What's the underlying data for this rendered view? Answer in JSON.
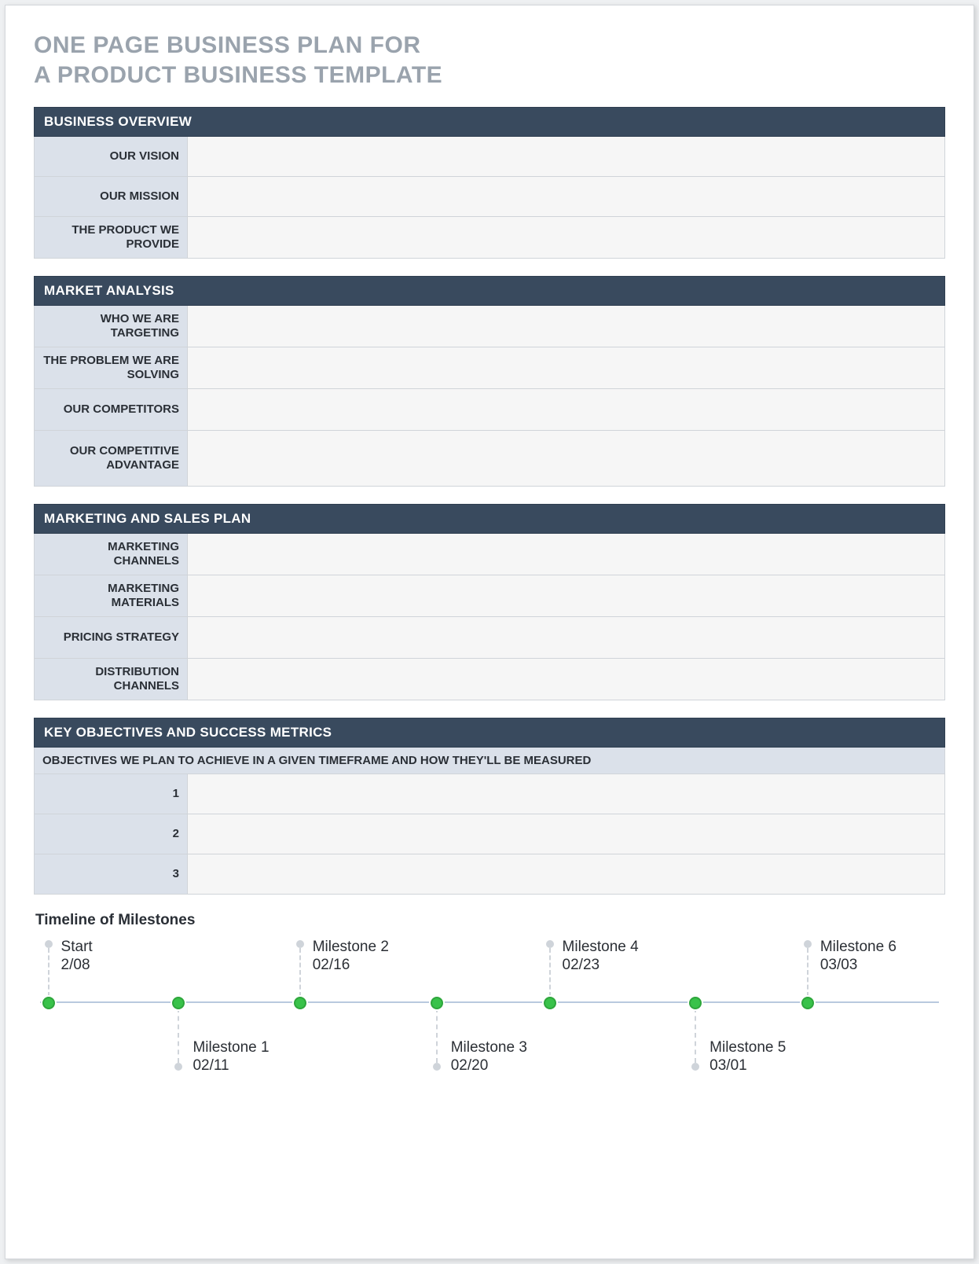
{
  "title_line1": "ONE PAGE BUSINESS PLAN FOR",
  "title_line2": "A PRODUCT BUSINESS TEMPLATE",
  "sections": {
    "overview": {
      "header": "BUSINESS OVERVIEW",
      "rows": [
        {
          "label": "OUR VISION",
          "value": ""
        },
        {
          "label": "OUR MISSION",
          "value": ""
        },
        {
          "label": "THE PRODUCT WE PROVIDE",
          "value": ""
        }
      ]
    },
    "market": {
      "header": "MARKET ANALYSIS",
      "rows": [
        {
          "label": "WHO WE ARE TARGETING",
          "value": ""
        },
        {
          "label": "THE PROBLEM WE ARE SOLVING",
          "value": ""
        },
        {
          "label": "OUR COMPETITORS",
          "value": ""
        },
        {
          "label": "OUR COMPETITIVE ADVANTAGE",
          "value": ""
        }
      ]
    },
    "marketing": {
      "header": "MARKETING AND SALES PLAN",
      "rows": [
        {
          "label": "MARKETING CHANNELS",
          "value": ""
        },
        {
          "label": "MARKETING MATERIALS",
          "value": ""
        },
        {
          "label": "PRICING STRATEGY",
          "value": ""
        },
        {
          "label": "DISTRIBUTION CHANNELS",
          "value": ""
        }
      ]
    },
    "objectives": {
      "header": "KEY OBJECTIVES AND SUCCESS METRICS",
      "subheader": "OBJECTIVES WE PLAN TO ACHIEVE IN A GIVEN TIMEFRAME AND HOW THEY'LL BE MEASURED",
      "rows": [
        {
          "label": "1",
          "value": ""
        },
        {
          "label": "2",
          "value": ""
        },
        {
          "label": "3",
          "value": ""
        }
      ]
    }
  },
  "timeline": {
    "title": "Timeline of Milestones",
    "points": [
      {
        "side": "above",
        "pct": 1.6,
        "name": "Start",
        "date": "2/08"
      },
      {
        "side": "below",
        "pct": 15.9,
        "name": "Milestone 1",
        "date": "02/11"
      },
      {
        "side": "above",
        "pct": 29.2,
        "name": "Milestone 2",
        "date": "02/16"
      },
      {
        "side": "below",
        "pct": 44.2,
        "name": "Milestone 3",
        "date": "02/20"
      },
      {
        "side": "above",
        "pct": 56.6,
        "name": "Milestone 4",
        "date": "02/23"
      },
      {
        "side": "below",
        "pct": 72.6,
        "name": "Milestone 5",
        "date": "03/01"
      },
      {
        "side": "above",
        "pct": 84.9,
        "name": "Milestone 6",
        "date": "03/03"
      }
    ]
  }
}
